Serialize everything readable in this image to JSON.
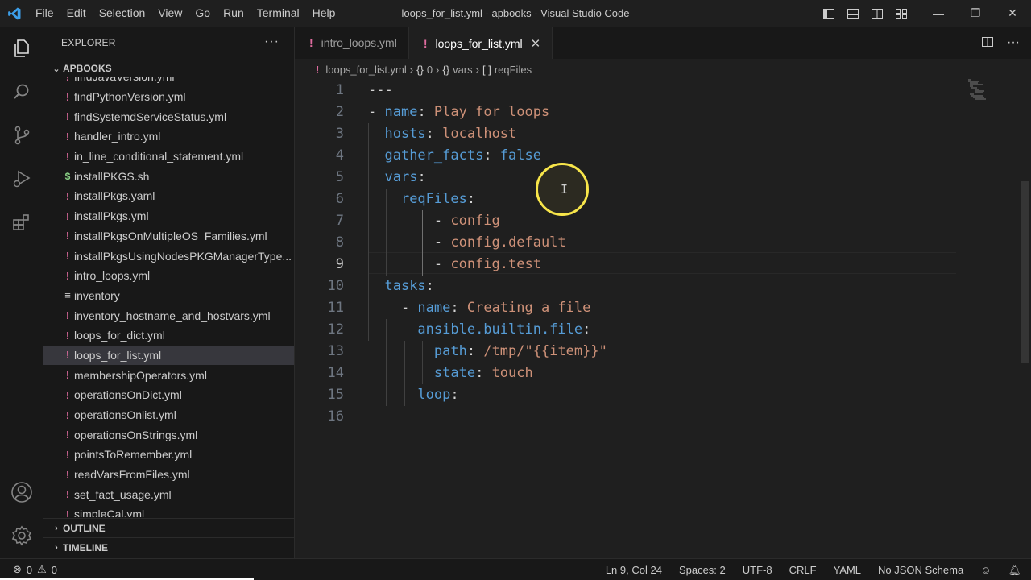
{
  "window": {
    "title": "loops_for_list.yml - apbooks - Visual Studio Code",
    "menu": [
      "File",
      "Edit",
      "Selection",
      "View",
      "Go",
      "Run",
      "Terminal",
      "Help"
    ],
    "controls": {
      "minimize": "—",
      "restore": "❐",
      "close": "✕"
    }
  },
  "activity_bar": [
    "explorer-icon",
    "search-icon",
    "source-control-icon",
    "run-debug-icon",
    "extensions-icon",
    "account-icon",
    "settings-gear-icon"
  ],
  "sidebar": {
    "header": "EXPLORER",
    "more": "···",
    "folder": "APBOOKS",
    "files": [
      {
        "name": "findJavaVersion.yml",
        "type": "yml"
      },
      {
        "name": "findPythonVersion.yml",
        "type": "yml"
      },
      {
        "name": "findSystemdServiceStatus.yml",
        "type": "yml"
      },
      {
        "name": "handler_intro.yml",
        "type": "yml"
      },
      {
        "name": "in_line_conditional_statement.yml",
        "type": "yml"
      },
      {
        "name": "installPKGS.sh",
        "type": "sh"
      },
      {
        "name": "installPkgs.yaml",
        "type": "yml"
      },
      {
        "name": "installPkgs.yml",
        "type": "yml"
      },
      {
        "name": "installPkgsOnMultipleOS_Families.yml",
        "type": "yml"
      },
      {
        "name": "installPkgsUsingNodesPKGManagerType...",
        "type": "yml"
      },
      {
        "name": "intro_loops.yml",
        "type": "yml"
      },
      {
        "name": "inventory",
        "type": "txt"
      },
      {
        "name": "inventory_hostname_and_hostvars.yml",
        "type": "yml"
      },
      {
        "name": "loops_for_dict.yml",
        "type": "yml"
      },
      {
        "name": "loops_for_list.yml",
        "type": "yml",
        "active": true
      },
      {
        "name": "membershipOperators.yml",
        "type": "yml"
      },
      {
        "name": "operationsOnDict.yml",
        "type": "yml"
      },
      {
        "name": "operationsOnlist.yml",
        "type": "yml"
      },
      {
        "name": "operationsOnStrings.yml",
        "type": "yml"
      },
      {
        "name": "pointsToRemember.yml",
        "type": "yml"
      },
      {
        "name": "readVarsFromFiles.yml",
        "type": "yml"
      },
      {
        "name": "set_fact_usage.yml",
        "type": "yml"
      },
      {
        "name": "simpleCal.yml",
        "type": "yml"
      }
    ],
    "outline": "OUTLINE",
    "timeline": "TIMELINE"
  },
  "tabs": [
    {
      "label": "intro_loops.yml",
      "active": false
    },
    {
      "label": "loops_for_list.yml",
      "active": true
    }
  ],
  "breadcrumb": {
    "file": "loops_for_list.yml",
    "seg1": "0",
    "seg2": "vars",
    "seg3": "reqFiles"
  },
  "code_lines": [
    {
      "n": "1",
      "tokens": [
        [
          "p",
          "---"
        ]
      ]
    },
    {
      "n": "2",
      "tokens": [
        [
          "p",
          "- "
        ],
        [
          "k",
          "name"
        ],
        [
          "p",
          ": "
        ],
        [
          "s",
          "Play for loops"
        ]
      ]
    },
    {
      "n": "3",
      "tokens": [
        [
          "p",
          "  "
        ],
        [
          "k",
          "hosts"
        ],
        [
          "p",
          ": "
        ],
        [
          "s",
          "localhost"
        ]
      ]
    },
    {
      "n": "4",
      "tokens": [
        [
          "p",
          "  "
        ],
        [
          "k",
          "gather_facts"
        ],
        [
          "p",
          ": "
        ],
        [
          "k",
          "false"
        ]
      ]
    },
    {
      "n": "5",
      "tokens": [
        [
          "p",
          "  "
        ],
        [
          "k",
          "vars"
        ],
        [
          "p",
          ":"
        ]
      ]
    },
    {
      "n": "6",
      "tokens": [
        [
          "p",
          "    "
        ],
        [
          "k",
          "reqFiles"
        ],
        [
          "p",
          ":"
        ]
      ]
    },
    {
      "n": "7",
      "tokens": [
        [
          "p",
          "        - "
        ],
        [
          "s",
          "config"
        ]
      ]
    },
    {
      "n": "8",
      "tokens": [
        [
          "p",
          "        - "
        ],
        [
          "s",
          "config.default"
        ]
      ]
    },
    {
      "n": "9",
      "tokens": [
        [
          "p",
          "        - "
        ],
        [
          "s",
          "config.test"
        ]
      ]
    },
    {
      "n": "10",
      "tokens": [
        [
          "p",
          "  "
        ],
        [
          "k",
          "tasks"
        ],
        [
          "p",
          ":"
        ]
      ]
    },
    {
      "n": "11",
      "tokens": [
        [
          "p",
          "    - "
        ],
        [
          "k",
          "name"
        ],
        [
          "p",
          ": "
        ],
        [
          "s",
          "Creating a file"
        ]
      ]
    },
    {
      "n": "12",
      "tokens": [
        [
          "p",
          "      "
        ],
        [
          "k",
          "ansible.builtin.file"
        ],
        [
          "p",
          ":"
        ]
      ]
    },
    {
      "n": "13",
      "tokens": [
        [
          "p",
          "        "
        ],
        [
          "k",
          "path"
        ],
        [
          "p",
          ": "
        ],
        [
          "s",
          "/tmp/\"{{item}}\""
        ]
      ]
    },
    {
      "n": "14",
      "tokens": [
        [
          "p",
          "        "
        ],
        [
          "k",
          "state"
        ],
        [
          "p",
          ": "
        ],
        [
          "s",
          "touch"
        ]
      ]
    },
    {
      "n": "15",
      "tokens": [
        [
          "p",
          "      "
        ],
        [
          "k",
          "loop"
        ],
        [
          "p",
          ":"
        ]
      ]
    },
    {
      "n": "16",
      "tokens": []
    }
  ],
  "current_line": "9",
  "status": {
    "errors": "0",
    "warnings": "0",
    "position": "Ln 9, Col 24",
    "spaces": "Spaces: 2",
    "encoding": "UTF-8",
    "eol": "CRLF",
    "language": "YAML",
    "schema": "No JSON Schema"
  },
  "colors": {
    "keyword": "#569cd6",
    "string": "#ce9178",
    "yml_icon": "#e06c9f",
    "cursor_highlight": "#f7e54a"
  }
}
